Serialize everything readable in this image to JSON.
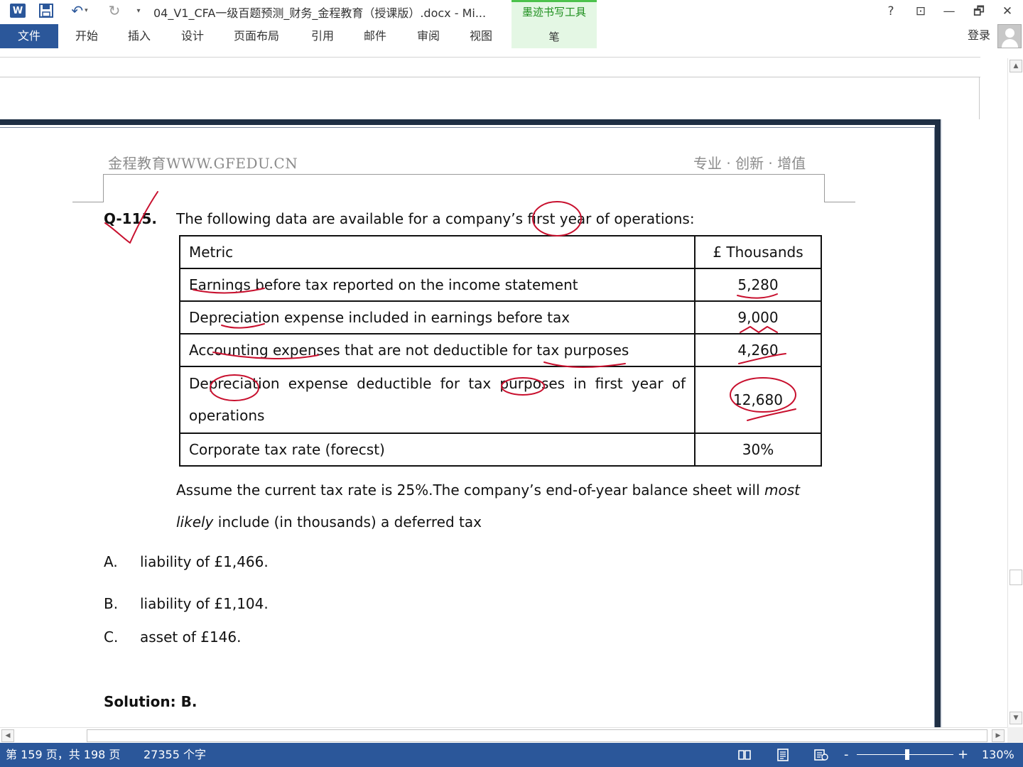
{
  "app": {
    "title": "04_V1_CFA一级百题预测_财务_金程教育（授课版）.docx - Mi...",
    "contextual_group": "墨迹书写工具",
    "contextual_tab": "笔",
    "help": "?",
    "ribbon_display": "⊡",
    "minimize": "—",
    "restore": "🗗",
    "close": "✕"
  },
  "ribbon": {
    "file": "文件",
    "tabs": [
      "开始",
      "插入",
      "设计",
      "页面布局",
      "引用",
      "邮件",
      "审阅",
      "视图"
    ],
    "signin": "登录"
  },
  "page_header": {
    "left": "金程教育WWW.GFEDU.CN",
    "right": "专业 · 创新 · 增值"
  },
  "question": {
    "number": "Q-115.",
    "stem": "The following data are available for a company’s first year of operations:",
    "table": {
      "headers": [
        "Metric",
        "£ Thousands"
      ],
      "rows": [
        {
          "metric": "Earnings before tax reported on the income statement",
          "value": "5,280"
        },
        {
          "metric": "Depreciation expense included in earnings before tax",
          "value": "9,000"
        },
        {
          "metric": "Accounting expenses that are not deductible for tax purposes",
          "value": "4,260"
        },
        {
          "metric": "Depreciation expense deductible for tax purposes in first year of operations",
          "value": "12,680"
        },
        {
          "metric": "Corporate tax rate (forecst)",
          "value": "30%"
        }
      ]
    },
    "assume_part1": "Assume the current tax rate is 25%.The company’s end-of-year balance sheet will ",
    "assume_em1": "most",
    "assume_em2": "likely",
    "assume_part2": " include (in thousands) a deferred tax",
    "options": [
      {
        "letter": "A.",
        "text": "liability of £1,466."
      },
      {
        "letter": "B.",
        "text": "liability of £1,104."
      },
      {
        "letter": "C.",
        "text": "asset of £146."
      }
    ],
    "solution": "Solution: B."
  },
  "status": {
    "page": "第 159 页，共 198 页",
    "words": "27355 个字",
    "zoom": "130%",
    "zoom_minus": "-",
    "zoom_plus": "+",
    "zoom_level": 0.5
  },
  "colors": {
    "accent": "#2b579a",
    "ink": "#c8102e",
    "contextual": "#e4f7e4"
  }
}
